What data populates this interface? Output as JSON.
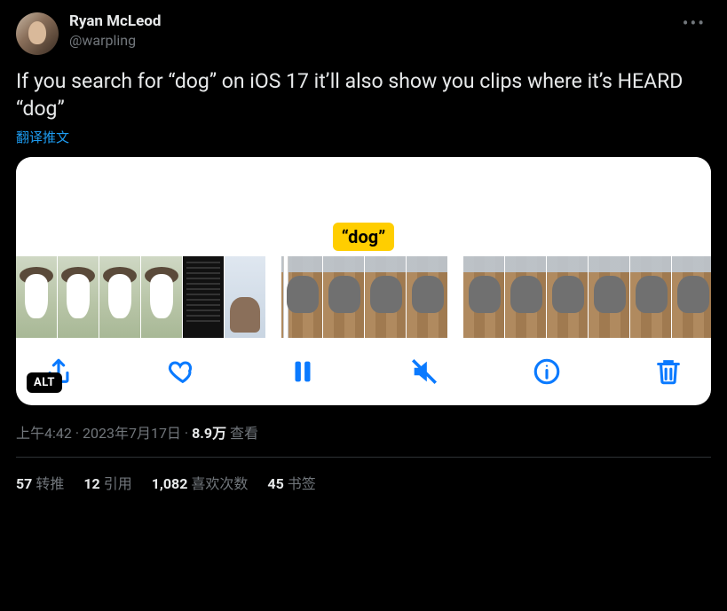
{
  "author": {
    "name": "Ryan McLeod",
    "handle": "@warpling"
  },
  "tweet_text": "If you search for “dog” on iOS 17 it’ll also show you clips where it’s HEARD “dog”",
  "translate_label": "翻译推文",
  "media": {
    "tag": "“dog”",
    "alt_badge": "ALT",
    "toolbar": {
      "share": "share",
      "like": "like",
      "pause": "pause",
      "mute": "mute",
      "info": "info",
      "delete": "delete"
    }
  },
  "meta": {
    "time": "上午4:42",
    "sep1": " · ",
    "date": "2023年7月17日",
    "sep2": " · ",
    "views_count": "8.9万",
    "views_label": " 查看"
  },
  "stats": {
    "retweets_n": "57",
    "retweets_label": "转推",
    "quotes_n": "12",
    "quotes_label": "引用",
    "likes_n": "1,082",
    "likes_label": "喜欢次数",
    "bookmarks_n": "45",
    "bookmarks_label": "书签"
  }
}
